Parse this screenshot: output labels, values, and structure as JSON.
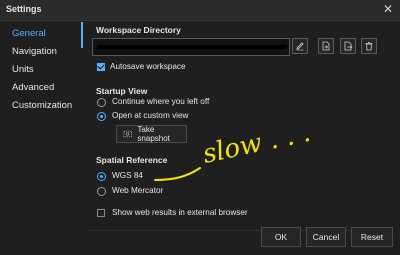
{
  "window": {
    "title": "Settings",
    "close_glyph": "✕"
  },
  "sidebar": {
    "items": [
      {
        "label": "General",
        "active": true
      },
      {
        "label": "Navigation",
        "active": false
      },
      {
        "label": "Units",
        "active": false
      },
      {
        "label": "Advanced",
        "active": false
      },
      {
        "label": "Customization",
        "active": false
      }
    ]
  },
  "workspace": {
    "title": "Workspace Directory",
    "path_value": "",
    "autosave_label": "Autosave workspace",
    "autosave_checked": true,
    "icons": [
      "edit-pencil-icon",
      "open-file-icon",
      "export-icon",
      "trash-icon"
    ]
  },
  "startup": {
    "title": "Startup View",
    "option_continue": "Continue where you left off",
    "option_custom": "Open at custom view",
    "selected": "custom",
    "snapshot_label": "Take snapshot"
  },
  "spatial_reference": {
    "title": "Spatial Reference",
    "option_wgs84": "WGS 84",
    "option_webmerc": "Web Mercator",
    "selected": "wgs84"
  },
  "web_results": {
    "label": "Show web results in external browser",
    "checked": false
  },
  "annotation": {
    "handwriting": "slow . . .",
    "color": "#f5e400"
  },
  "buttons": {
    "ok": "OK",
    "cancel": "Cancel",
    "reset": "Reset"
  },
  "colors": {
    "accent": "#4fb3ff",
    "background": "#1f1f1f"
  }
}
